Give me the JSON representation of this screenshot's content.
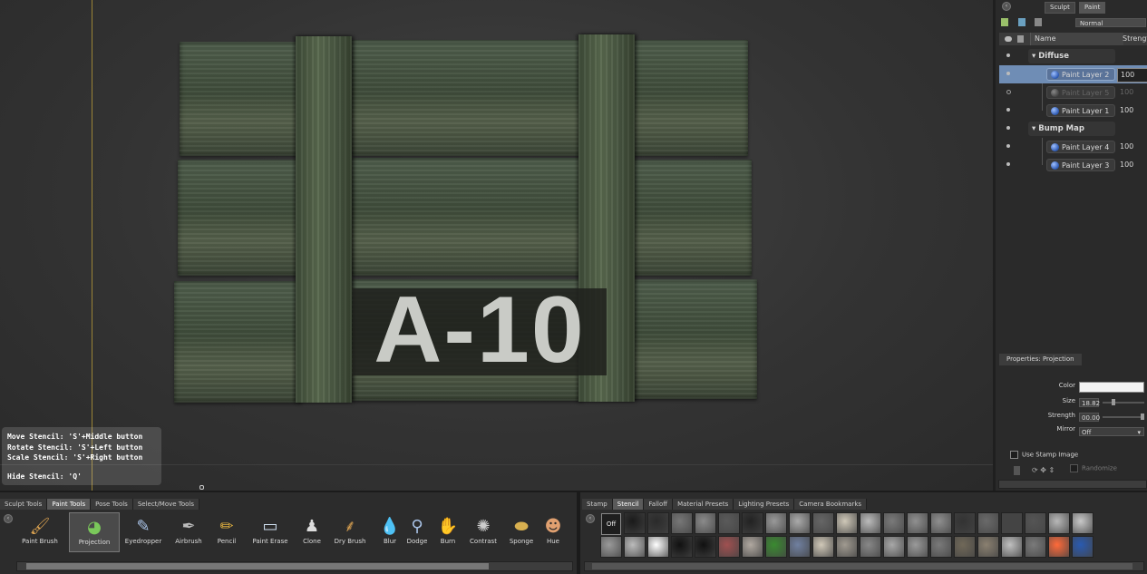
{
  "viewport": {
    "crate_label": "A-10",
    "stencil_help": [
      "Move Stencil: 'S'+Middle button",
      "Rotate Stencil: 'S'+Left button",
      "Scale Stencil: 'S'+Right button",
      "Hide Stencil: 'Q'"
    ]
  },
  "mode_tabs": [
    "Sculpt",
    "Paint"
  ],
  "layers": {
    "blend_mode": "Normal",
    "header_name": "Name",
    "header_strength": "Strength",
    "groups": [
      {
        "name": "Diffuse",
        "layers": [
          {
            "name": "Paint Layer 2",
            "strength": "100",
            "selected": true,
            "visible": true
          },
          {
            "name": "Paint Layer 5",
            "strength": "100",
            "selected": false,
            "visible": false
          },
          {
            "name": "Paint Layer 1",
            "strength": "100",
            "selected": false,
            "visible": true
          }
        ]
      },
      {
        "name": "Bump Map",
        "layers": [
          {
            "name": "Paint Layer 4",
            "strength": "100",
            "selected": false,
            "visible": true
          },
          {
            "name": "Paint Layer 3",
            "strength": "100",
            "selected": false,
            "visible": true
          }
        ]
      }
    ]
  },
  "properties": {
    "tab": "Properties: Projection",
    "color_label": "Color",
    "color_value": "#f4f4f4",
    "size_label": "Size",
    "size_value": "18.82",
    "strength_label": "Strength",
    "strength_value": "00.00",
    "mirror_label": "Mirror",
    "mirror_value": "Off",
    "use_stamp_label": "Use Stamp Image",
    "randomize_label": "Randomize"
  },
  "tool_tabs": [
    "Sculpt Tools",
    "Paint Tools",
    "Pose Tools",
    "Select/Move Tools"
  ],
  "tool_tabs_active": "Paint Tools",
  "tools": [
    {
      "label": "Paint Brush",
      "icon": "paint-brush-icon",
      "glyph": "🖌"
    },
    {
      "label": "Projection",
      "icon": "projection-icon",
      "glyph": "◕",
      "active": true
    },
    {
      "label": "Eyedropper",
      "icon": "eyedropper-icon",
      "glyph": "✎"
    },
    {
      "label": "Airbrush",
      "icon": "airbrush-icon",
      "glyph": "✒"
    },
    {
      "label": "Pencil",
      "icon": "pencil-icon",
      "glyph": "✏"
    },
    {
      "label": "Paint Erase",
      "icon": "eraser-icon",
      "glyph": "▭"
    },
    {
      "label": "Clone",
      "icon": "clone-stamp-icon",
      "glyph": "♟"
    },
    {
      "label": "Dry Brush",
      "icon": "dry-brush-icon",
      "glyph": "⸙"
    },
    {
      "label": "Blur",
      "icon": "blur-drop-icon",
      "glyph": "💧"
    },
    {
      "label": "Dodge",
      "icon": "dodge-icon",
      "glyph": "⚲"
    },
    {
      "label": "Burn",
      "icon": "burn-hand-icon",
      "glyph": "✋"
    },
    {
      "label": "Contrast",
      "icon": "contrast-icon",
      "glyph": "✺"
    },
    {
      "label": "Sponge",
      "icon": "sponge-icon",
      "glyph": "⬬"
    },
    {
      "label": "Hue",
      "icon": "hue-icon",
      "glyph": "☻"
    }
  ],
  "tray_tabs": [
    "Stamp",
    "Stencil",
    "Falloff",
    "Material Presets",
    "Lighting Presets",
    "Camera Bookmarks"
  ],
  "tray_tabs_active": "Stencil",
  "stencil_off_label": "Off",
  "colors": {
    "selected_row": "#6f8db5",
    "guide_line": "#b79a3a"
  }
}
